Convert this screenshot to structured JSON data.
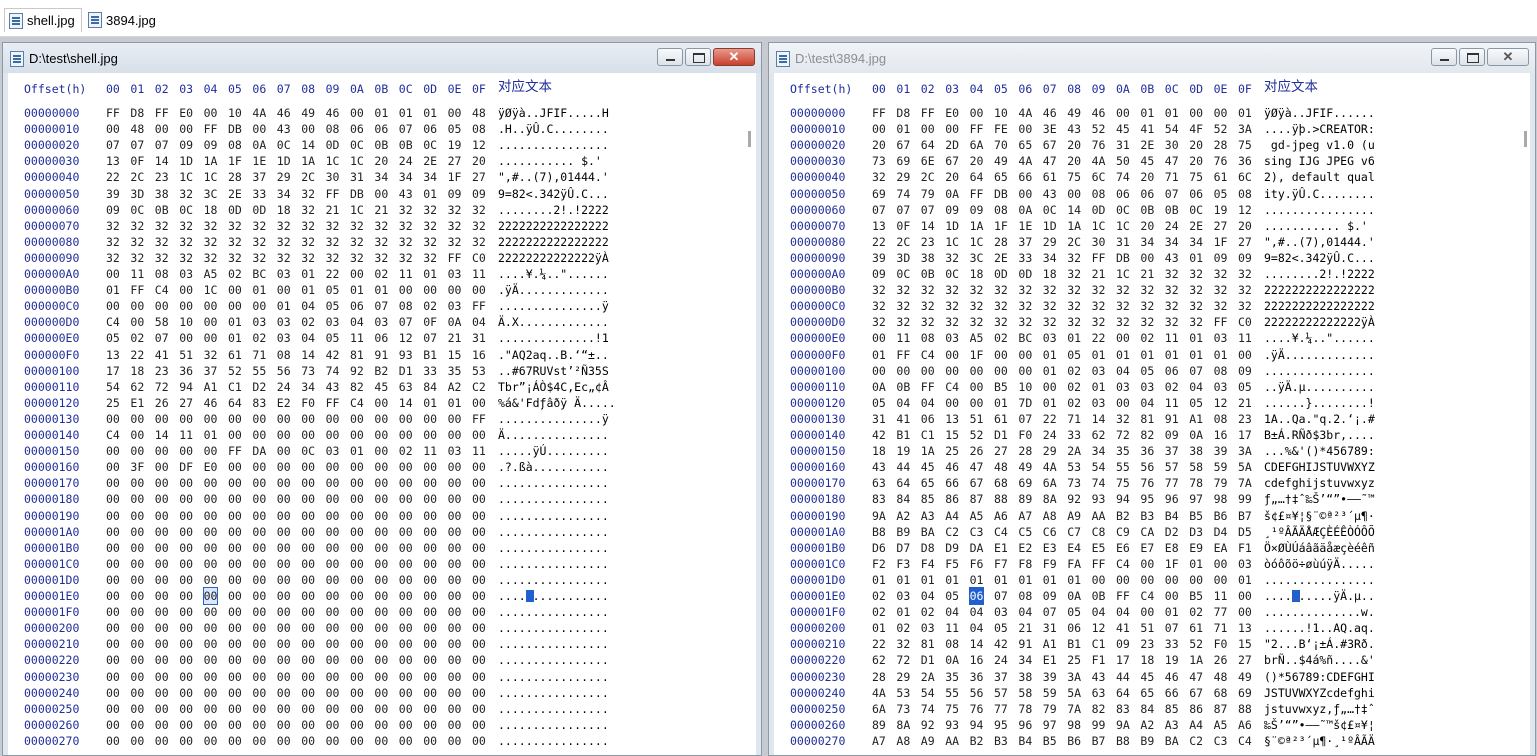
{
  "tabs": [
    {
      "label": "shell.jpg",
      "icon": "jpg-file-icon",
      "active": true
    },
    {
      "label": "3894.jpg",
      "icon": "jpg-file-icon",
      "active": false
    }
  ],
  "header": {
    "offset_label": "Offset(h)",
    "columns": [
      "00",
      "01",
      "02",
      "03",
      "04",
      "05",
      "06",
      "07",
      "08",
      "09",
      "0A",
      "0B",
      "0C",
      "0D",
      "0E",
      "0F"
    ],
    "text_label": "对应文本"
  },
  "windows": [
    {
      "title": "D:\\test\\shell.jpg",
      "selected": {
        "row": 30,
        "col": 4
      },
      "rows": [
        {
          "off": "00000000",
          "hex": "FF D8 FF E0 00 10 4A 46 49 46 00 01 01 01 00 48",
          "asc": "ÿØÿà..JFIF.....H"
        },
        {
          "off": "00000010",
          "hex": "00 48 00 00 FF DB 00 43 00 08 06 06 07 06 05 08",
          "asc": ".H..ÿÛ.C........"
        },
        {
          "off": "00000020",
          "hex": "07 07 07 09 09 08 0A 0C 14 0D 0C 0B 0B 0C 19 12",
          "asc": "................"
        },
        {
          "off": "00000030",
          "hex": "13 0F 14 1D 1A 1F 1E 1D 1A 1C 1C 20 24 2E 27 20",
          "asc": "........... $.' "
        },
        {
          "off": "00000040",
          "hex": "22 2C 23 1C 1C 28 37 29 2C 30 31 34 34 34 1F 27",
          "asc": "\",#..(7),01444.'"
        },
        {
          "off": "00000050",
          "hex": "39 3D 38 32 3C 2E 33 34 32 FF DB 00 43 01 09 09",
          "asc": "9=82<.342ÿÛ.C..."
        },
        {
          "off": "00000060",
          "hex": "09 0C 0B 0C 18 0D 0D 18 32 21 1C 21 32 32 32 32",
          "asc": "........2!.!2222"
        },
        {
          "off": "00000070",
          "hex": "32 32 32 32 32 32 32 32 32 32 32 32 32 32 32 32",
          "asc": "2222222222222222"
        },
        {
          "off": "00000080",
          "hex": "32 32 32 32 32 32 32 32 32 32 32 32 32 32 32 32",
          "asc": "2222222222222222"
        },
        {
          "off": "00000090",
          "hex": "32 32 32 32 32 32 32 32 32 32 32 32 32 32 FF C0",
          "asc": "22222222222222ÿÀ"
        },
        {
          "off": "000000A0",
          "hex": "00 11 08 03 A5 02 BC 03 01 22 00 02 11 01 03 11",
          "asc": "....¥.¼..\"......"
        },
        {
          "off": "000000B0",
          "hex": "01 FF C4 00 1C 00 01 00 01 05 01 01 00 00 00 00",
          "asc": ".ÿÄ............."
        },
        {
          "off": "000000C0",
          "hex": "00 00 00 00 00 00 00 01 04 05 06 07 08 02 03 FF",
          "asc": "...............ÿ"
        },
        {
          "off": "000000D0",
          "hex": "C4 00 58 10 00 01 03 03 02 03 04 03 07 0F 0A 04",
          "asc": "Ä.X............."
        },
        {
          "off": "000000E0",
          "hex": "05 02 07 00 00 01 02 03 04 05 11 06 12 07 21 31",
          "asc": "..............!1"
        },
        {
          "off": "000000F0",
          "hex": "13 22 41 51 32 61 71 08 14 42 81 91 93 B1 15 16",
          "asc": ".\"AQ2aq..B.‘“±.."
        },
        {
          "off": "00000100",
          "hex": "17 18 23 36 37 52 55 56 73 74 92 B2 D1 33 35 53",
          "asc": "..#67RUVst’²Ñ35S"
        },
        {
          "off": "00000110",
          "hex": "54 62 72 94 A1 C1 D2 24 34 43 82 45 63 84 A2 C2",
          "asc": "Tbr”¡ÁÒ$4C‚Ec„¢Â"
        },
        {
          "off": "00000120",
          "hex": "25 E1 26 27 46 64 83 E2 F0 FF C4 00 14 01 01 00",
          "asc": "%á&'Fdƒâðÿ Ä....."
        },
        {
          "off": "00000130",
          "hex": "00 00 00 00 00 00 00 00 00 00 00 00 00 00 00 FF",
          "asc": "...............ÿ"
        },
        {
          "off": "00000140",
          "hex": "C4 00 14 11 01 00 00 00 00 00 00 00 00 00 00 00",
          "asc": "Ä..............."
        },
        {
          "off": "00000150",
          "hex": "00 00 00 00 00 FF DA 00 0C 03 01 00 02 11 03 11",
          "asc": ".....ÿÚ........."
        },
        {
          "off": "00000160",
          "hex": "00 3F 00 DF E0 00 00 00 00 00 00 00 00 00 00 00",
          "asc": ".?.ßà..........."
        },
        {
          "off": "00000170",
          "hex": "00 00 00 00 00 00 00 00 00 00 00 00 00 00 00 00",
          "asc": "................"
        },
        {
          "off": "00000180",
          "hex": "00 00 00 00 00 00 00 00 00 00 00 00 00 00 00 00",
          "asc": "................"
        },
        {
          "off": "00000190",
          "hex": "00 00 00 00 00 00 00 00 00 00 00 00 00 00 00 00",
          "asc": "................"
        },
        {
          "off": "000001A0",
          "hex": "00 00 00 00 00 00 00 00 00 00 00 00 00 00 00 00",
          "asc": "................"
        },
        {
          "off": "000001B0",
          "hex": "00 00 00 00 00 00 00 00 00 00 00 00 00 00 00 00",
          "asc": "................"
        },
        {
          "off": "000001C0",
          "hex": "00 00 00 00 00 00 00 00 00 00 00 00 00 00 00 00",
          "asc": "................"
        },
        {
          "off": "000001D0",
          "hex": "00 00 00 00 00 00 00 00 00 00 00 00 00 00 00 00",
          "asc": "................"
        },
        {
          "off": "000001E0",
          "hex": "00 00 00 00 00 00 00 00 00 00 00 00 00 00 00 00",
          "asc": "................"
        },
        {
          "off": "000001F0",
          "hex": "00 00 00 00 00 00 00 00 00 00 00 00 00 00 00 00",
          "asc": "................"
        },
        {
          "off": "00000200",
          "hex": "00 00 00 00 00 00 00 00 00 00 00 00 00 00 00 00",
          "asc": "................"
        },
        {
          "off": "00000210",
          "hex": "00 00 00 00 00 00 00 00 00 00 00 00 00 00 00 00",
          "asc": "................"
        },
        {
          "off": "00000220",
          "hex": "00 00 00 00 00 00 00 00 00 00 00 00 00 00 00 00",
          "asc": "................"
        },
        {
          "off": "00000230",
          "hex": "00 00 00 00 00 00 00 00 00 00 00 00 00 00 00 00",
          "asc": "................"
        },
        {
          "off": "00000240",
          "hex": "00 00 00 00 00 00 00 00 00 00 00 00 00 00 00 00",
          "asc": "................"
        },
        {
          "off": "00000250",
          "hex": "00 00 00 00 00 00 00 00 00 00 00 00 00 00 00 00",
          "asc": "................"
        },
        {
          "off": "00000260",
          "hex": "00 00 00 00 00 00 00 00 00 00 00 00 00 00 00 00",
          "asc": "................"
        },
        {
          "off": "00000270",
          "hex": "00 00 00 00 00 00 00 00 00 00 00 00 00 00 00 00",
          "asc": "................"
        }
      ]
    },
    {
      "title": "D:\\test\\3894.jpg",
      "selected": {
        "row": 30,
        "col": 4
      },
      "rows": [
        {
          "off": "00000000",
          "hex": "FF D8 FF E0 00 10 4A 46 49 46 00 01 01 00 00 01",
          "asc": "ÿØÿà..JFIF......"
        },
        {
          "off": "00000010",
          "hex": "00 01 00 00 FF FE 00 3E 43 52 45 41 54 4F 52 3A",
          "asc": "....ÿþ.>CREATOR:"
        },
        {
          "off": "00000020",
          "hex": "20 67 64 2D 6A 70 65 67 20 76 31 2E 30 20 28 75",
          "asc": " gd-jpeg v1.0 (u"
        },
        {
          "off": "00000030",
          "hex": "73 69 6E 67 20 49 4A 47 20 4A 50 45 47 20 76 36",
          "asc": "sing IJG JPEG v6"
        },
        {
          "off": "00000040",
          "hex": "32 29 2C 20 64 65 66 61 75 6C 74 20 71 75 61 6C",
          "asc": "2), default qual"
        },
        {
          "off": "00000050",
          "hex": "69 74 79 0A FF DB 00 43 00 08 06 06 07 06 05 08",
          "asc": "ity.ÿÛ.C........"
        },
        {
          "off": "00000060",
          "hex": "07 07 07 09 09 08 0A 0C 14 0D 0C 0B 0B 0C 19 12",
          "asc": "................"
        },
        {
          "off": "00000070",
          "hex": "13 0F 14 1D 1A 1F 1E 1D 1A 1C 1C 20 24 2E 27 20",
          "asc": "........... $.' "
        },
        {
          "off": "00000080",
          "hex": "22 2C 23 1C 1C 28 37 29 2C 30 31 34 34 34 1F 27",
          "asc": "\",#..(7),01444.'"
        },
        {
          "off": "00000090",
          "hex": "39 3D 38 32 3C 2E 33 34 32 FF DB 00 43 01 09 09",
          "asc": "9=82<.342ÿÛ.C..."
        },
        {
          "off": "000000A0",
          "hex": "09 0C 0B 0C 18 0D 0D 18 32 21 1C 21 32 32 32 32",
          "asc": "........2!.!2222"
        },
        {
          "off": "000000B0",
          "hex": "32 32 32 32 32 32 32 32 32 32 32 32 32 32 32 32",
          "asc": "2222222222222222"
        },
        {
          "off": "000000C0",
          "hex": "32 32 32 32 32 32 32 32 32 32 32 32 32 32 32 32",
          "asc": "2222222222222222"
        },
        {
          "off": "000000D0",
          "hex": "32 32 32 32 32 32 32 32 32 32 32 32 32 32 FF C0",
          "asc": "22222222222222ÿÀ"
        },
        {
          "off": "000000E0",
          "hex": "00 11 08 03 A5 02 BC 03 01 22 00 02 11 01 03 11",
          "asc": "....¥.¼..\"......"
        },
        {
          "off": "000000F0",
          "hex": "01 FF C4 00 1F 00 00 01 05 01 01 01 01 01 01 00",
          "asc": ".ÿÄ............."
        },
        {
          "off": "00000100",
          "hex": "00 00 00 00 00 00 00 01 02 03 04 05 06 07 08 09",
          "asc": "................"
        },
        {
          "off": "00000110",
          "hex": "0A 0B FF C4 00 B5 10 00 02 01 03 03 02 04 03 05",
          "asc": "..ÿÄ.µ.........."
        },
        {
          "off": "00000120",
          "hex": "05 04 04 00 00 01 7D 01 02 03 00 04 11 05 12 21",
          "asc": "......}........!"
        },
        {
          "off": "00000130",
          "hex": "31 41 06 13 51 61 07 22 71 14 32 81 91 A1 08 23",
          "asc": "1A..Qa.\"q.2.‘¡.#"
        },
        {
          "off": "00000140",
          "hex": "42 B1 C1 15 52 D1 F0 24 33 62 72 82 09 0A 16 17",
          "asc": "B±Á.RÑð$3br‚...."
        },
        {
          "off": "00000150",
          "hex": "18 19 1A 25 26 27 28 29 2A 34 35 36 37 38 39 3A",
          "asc": "...%&'()*456789:"
        },
        {
          "off": "00000160",
          "hex": "43 44 45 46 47 48 49 4A 53 54 55 56 57 58 59 5A",
          "asc": "CDEFGHIJSTUVWXYZ"
        },
        {
          "off": "00000170",
          "hex": "63 64 65 66 67 68 69 6A 73 74 75 76 77 78 79 7A",
          "asc": "cdefghijstuvwxyz"
        },
        {
          "off": "00000180",
          "hex": "83 84 85 86 87 88 89 8A 92 93 94 95 96 97 98 99",
          "asc": "ƒ„…†‡ˆ‰Š’“”•–—˜™"
        },
        {
          "off": "00000190",
          "hex": "9A A2 A3 A4 A5 A6 A7 A8 A9 AA B2 B3 B4 B5 B6 B7",
          "asc": "š¢£¤¥¦§¨©ª²³´µ¶·"
        },
        {
          "off": "000001A0",
          "hex": "B8 B9 BA C2 C3 C4 C5 C6 C7 C8 C9 CA D2 D3 D4 D5",
          "asc": "¸¹ºÂÃÄÅÆÇÈÉÊÒÓÔÕ"
        },
        {
          "off": "000001B0",
          "hex": "D6 D7 D8 D9 DA E1 E2 E3 E4 E5 E6 E7 E8 E9 EA F1",
          "asc": "Ö×ØÙÚáâãäåæçèéêñ"
        },
        {
          "off": "000001C0",
          "hex": "F2 F3 F4 F5 F6 F7 F8 F9 FA FF C4 00 1F 01 00 03",
          "asc": "òóôõö÷øùúÿÄ....."
        },
        {
          "off": "000001D0",
          "hex": "01 01 01 01 01 01 01 01 01 00 00 00 00 00 00 01",
          "asc": "................"
        },
        {
          "off": "000001E0",
          "hex": "02 03 04 05 06 07 08 09 0A 0B FF C4 00 B5 11 00",
          "asc": "..........ÿÄ.µ.."
        },
        {
          "off": "000001F0",
          "hex": "02 01 02 04 04 03 04 07 05 04 04 00 01 02 77 00",
          "asc": "..............w."
        },
        {
          "off": "00000200",
          "hex": "01 02 03 11 04 05 21 31 06 12 41 51 07 61 71 13",
          "asc": "......!1..AQ.aq."
        },
        {
          "off": "00000210",
          "hex": "22 32 81 08 14 42 91 A1 B1 C1 09 23 33 52 F0 15",
          "asc": "\"2...B‘¡±Á.#3Rð."
        },
        {
          "off": "00000220",
          "hex": "62 72 D1 0A 16 24 34 E1 25 F1 17 18 19 1A 26 27",
          "asc": "brÑ..$4á%ñ....&'"
        },
        {
          "off": "00000230",
          "hex": "28 29 2A 35 36 37 38 39 3A 43 44 45 46 47 48 49",
          "asc": "()*56789:CDEFGHI"
        },
        {
          "off": "00000240",
          "hex": "4A 53 54 55 56 57 58 59 5A 63 64 65 66 67 68 69",
          "asc": "JSTUVWXYZcdefghi"
        },
        {
          "off": "00000250",
          "hex": "6A 73 74 75 76 77 78 79 7A 82 83 84 85 86 87 88",
          "asc": "jstuvwxyz‚ƒ„…†‡ˆ"
        },
        {
          "off": "00000260",
          "hex": "89 8A 92 93 94 95 96 97 98 99 9A A2 A3 A4 A5 A6",
          "asc": "‰Š’“”•–—˜™š¢£¤¥¦"
        },
        {
          "off": "00000270",
          "hex": "A7 A8 A9 AA B2 B3 B4 B5 B6 B7 B8 B9 BA C2 C3 C4",
          "asc": "§¨©ª²³´µ¶·¸¹ºÂÃÄ"
        }
      ]
    }
  ],
  "colors": {
    "offset_blue": "#1f2e9a",
    "selection": "#1f5fd0"
  }
}
